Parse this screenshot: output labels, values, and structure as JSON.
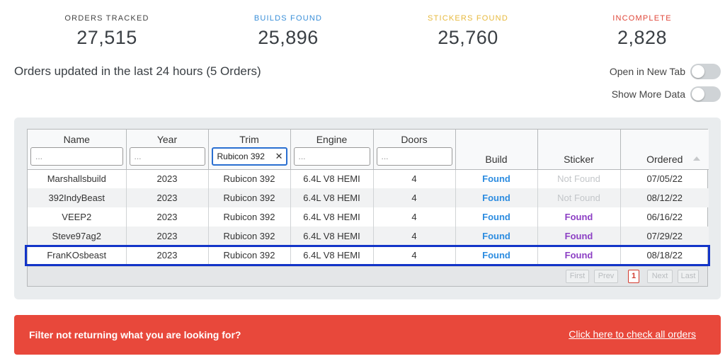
{
  "stats": [
    {
      "label": "ORDERS TRACKED",
      "value": "27,515",
      "color": "#444444"
    },
    {
      "label": "BUILDS FOUND",
      "value": "25,896",
      "color": "#3a8fd9"
    },
    {
      "label": "STICKERS FOUND",
      "value": "25,760",
      "color": "#e7b93d"
    },
    {
      "label": "INCOMPLETE",
      "value": "2,828",
      "color": "#e0473a"
    }
  ],
  "orders_title": "Orders updated in the last 24 hours (5 Orders)",
  "toggles": [
    {
      "label": "Open in New Tab",
      "on": false
    },
    {
      "label": "Show More Data",
      "on": false
    }
  ],
  "table": {
    "columns": [
      "Name",
      "Year",
      "Trim",
      "Engine",
      "Doors",
      "Build",
      "Sticker",
      "Ordered"
    ],
    "filters": {
      "name": {
        "value": "",
        "placeholder": "..."
      },
      "year": {
        "value": "",
        "placeholder": "..."
      },
      "trim": {
        "value": "Rubicon 392",
        "placeholder": "..."
      },
      "engine": {
        "value": "",
        "placeholder": "..."
      },
      "doors": {
        "value": "",
        "placeholder": "..."
      }
    },
    "rows": [
      {
        "name": "Marshallsbuild",
        "year": "2023",
        "trim": "Rubicon 392",
        "engine": "6.4L V8 HEMI",
        "doors": "4",
        "build": "Found",
        "sticker": "Not Found",
        "ordered": "07/05/22"
      },
      {
        "name": "392IndyBeast",
        "year": "2023",
        "trim": "Rubicon 392",
        "engine": "6.4L V8 HEMI",
        "doors": "4",
        "build": "Found",
        "sticker": "Not Found",
        "ordered": "08/12/22"
      },
      {
        "name": "VEEP2",
        "year": "2023",
        "trim": "Rubicon 392",
        "engine": "6.4L V8 HEMI",
        "doors": "4",
        "build": "Found",
        "sticker": "Found",
        "ordered": "06/16/22"
      },
      {
        "name": "Steve97ag2",
        "year": "2023",
        "trim": "Rubicon 392",
        "engine": "6.4L V8 HEMI",
        "doors": "4",
        "build": "Found",
        "sticker": "Found",
        "ordered": "07/29/22"
      },
      {
        "name": "FranKOsbeast",
        "year": "2023",
        "trim": "Rubicon 392",
        "engine": "6.4L V8 HEMI",
        "doors": "4",
        "build": "Found",
        "sticker": "Found",
        "ordered": "08/18/22"
      }
    ],
    "pagination": {
      "first": "First",
      "prev": "Prev",
      "page": "1",
      "next": "Next",
      "last": "Last"
    }
  },
  "banner": {
    "message": "Filter not returning what you are looking for?",
    "link": "Click here to check all orders",
    "color": "#e8483b"
  }
}
